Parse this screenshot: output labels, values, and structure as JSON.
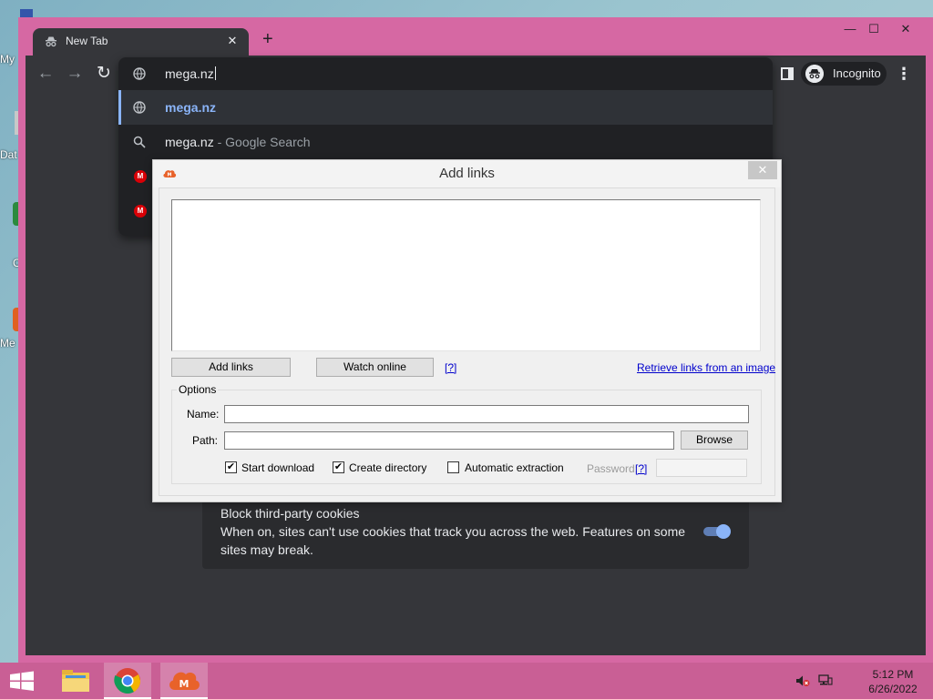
{
  "desktop": {
    "icon_labels": [
      "My",
      "Dat",
      "C",
      "Me"
    ]
  },
  "browser": {
    "tab_title": "New Tab",
    "tab_close": "✕",
    "new_tab": "+",
    "window_minimize": "—",
    "window_maximize": "☐",
    "window_close": "✕",
    "incognito_label": "Incognito",
    "menu": "⋮",
    "back": "←",
    "forward": "→",
    "reload": "↻"
  },
  "omnibox": {
    "input_value": "mega.nz",
    "suggestions": [
      {
        "text": "mega.nz",
        "suffix": "",
        "icon": "globe-icon",
        "selected": true
      },
      {
        "text": "mega.nz",
        "suffix": " - Google Search",
        "icon": "search-icon",
        "selected": false
      },
      {
        "text": "",
        "suffix": "",
        "icon": "mega-icon",
        "selected": false
      },
      {
        "text": "",
        "suffix": "",
        "icon": "mega-icon",
        "selected": false
      }
    ]
  },
  "cookies": {
    "title": "Block third-party cookies",
    "description": "When on, sites can't use cookies that track you across the web. Features on some sites may break.",
    "enabled": true
  },
  "dialog": {
    "title": "Add links",
    "close": "✕",
    "add_links_button": "Add links",
    "watch_online_button": "Watch online",
    "help_link": "[?]",
    "retrieve_link": "Retrieve links from an image",
    "options_legend": "Options",
    "name_label": "Name:",
    "name_value": "",
    "path_label": "Path:",
    "path_value": "",
    "browse_button": "Browse",
    "start_download_label": "Start download",
    "start_download_checked": true,
    "create_directory_label": "Create directory",
    "create_directory_checked": true,
    "automatic_extraction_label": "Automatic extraction",
    "automatic_extraction_checked": false,
    "password_label": "Password:",
    "password_help": "[?]",
    "check_mark": "✔"
  },
  "taskbar": {
    "time": "5:12 PM",
    "date": "6/26/2022",
    "mega_letter": "M"
  },
  "colors": {
    "chrome_frame": "#d668a3",
    "taskbar": "#c95f95",
    "dark_bg": "#35363a",
    "accent_blue": "#8ab4f8",
    "mega_red": "#d90007"
  }
}
